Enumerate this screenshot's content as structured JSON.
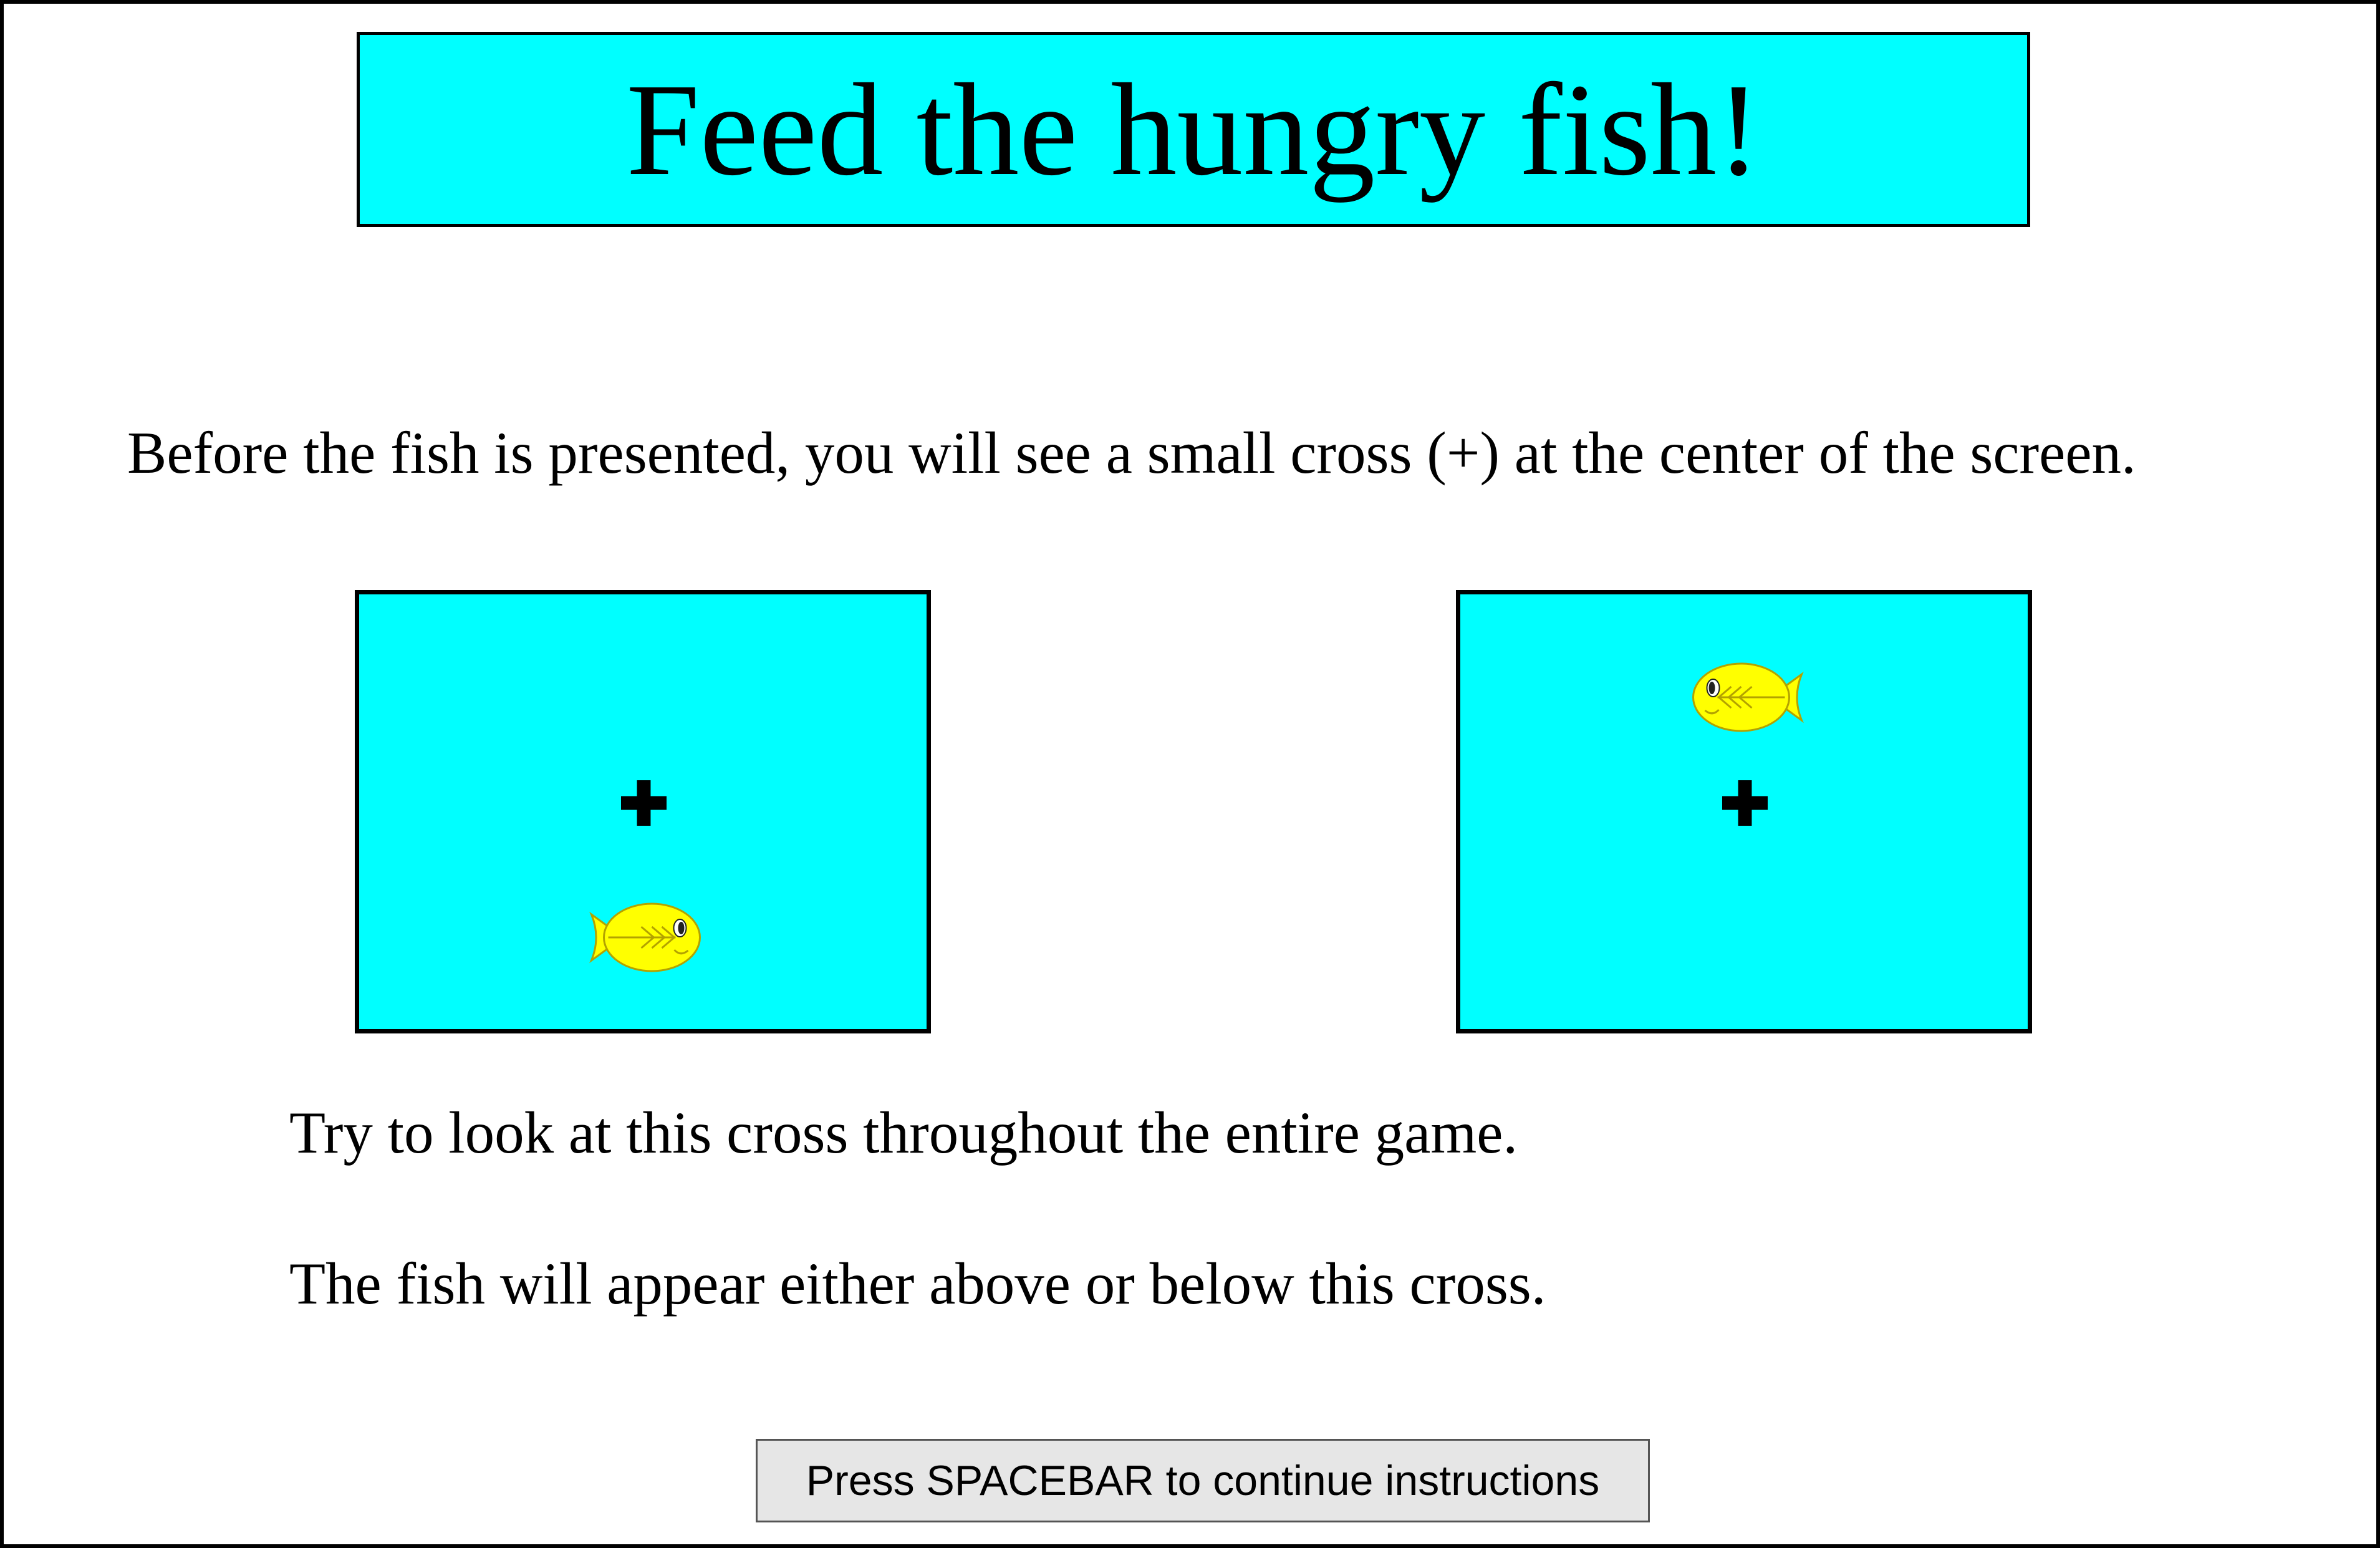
{
  "title": "Feed the hungry fish!",
  "instructions": {
    "intro": "Before the fish is presented, you will see a small cross (+) at the center of the screen.",
    "look": "Try to look at this cross throughout the entire game.",
    "fish_position": "The fish will appear either above or below this cross."
  },
  "examples": [
    {
      "fixation": "cross-icon",
      "fish": "fish-icon",
      "fish_position": "below",
      "fish_facing": "right"
    },
    {
      "fixation": "cross-icon",
      "fish": "fish-icon",
      "fish_position": "above",
      "fish_facing": "left"
    }
  ],
  "continue_button": "Press SPACEBAR to continue instructions",
  "colors": {
    "background": "#ffffff",
    "panel": "#00ffff",
    "fish_body": "#ffff00",
    "fish_outline": "#b3a200",
    "cross": "#000000",
    "button": "#e6e6e6"
  }
}
